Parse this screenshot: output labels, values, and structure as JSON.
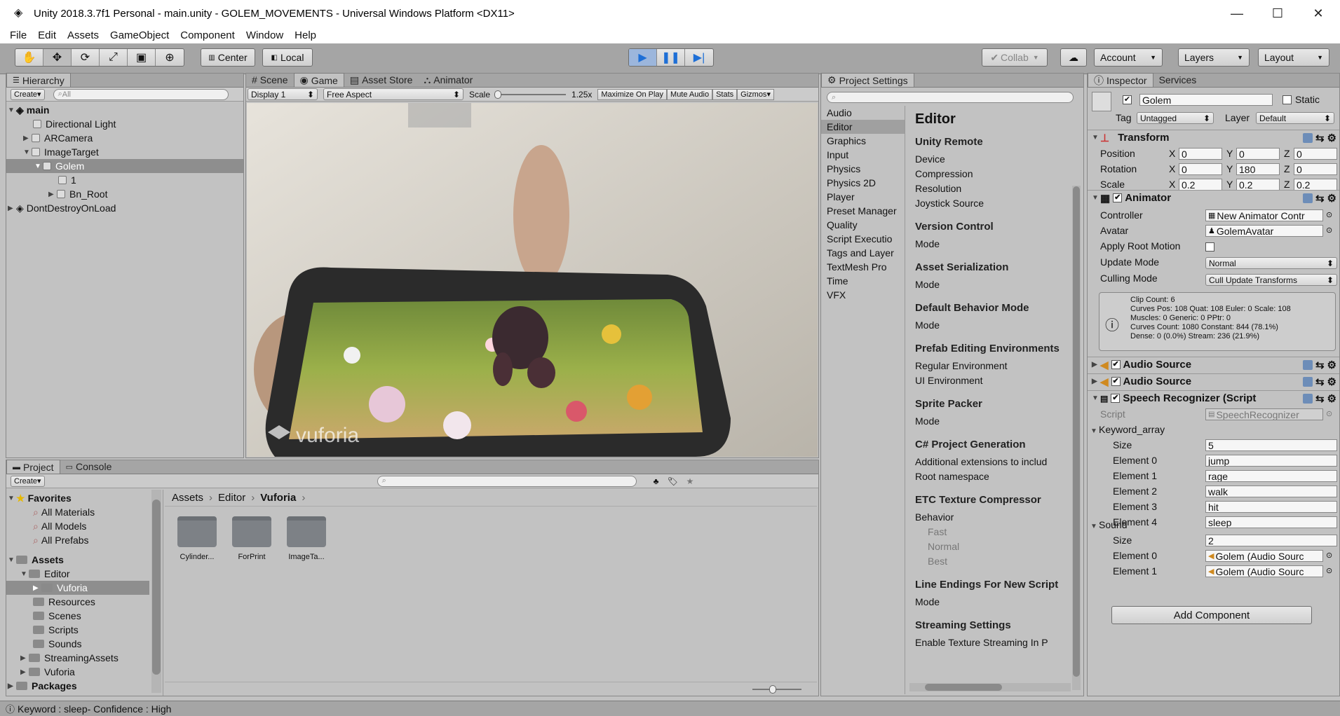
{
  "window": {
    "title": "Unity 2018.3.7f1 Personal - main.unity - GOLEM_MOVEMENTS - Universal Windows Platform <DX11>",
    "minimize": "—",
    "maximize": "☐",
    "close": "✕"
  },
  "menu": [
    "File",
    "Edit",
    "Assets",
    "GameObject",
    "Component",
    "Window",
    "Help"
  ],
  "toolbar": {
    "pivot": "Center",
    "space": "Local",
    "collab": "Collab",
    "account": "Account",
    "layers": "Layers",
    "layout": "Layout"
  },
  "hierarchy": {
    "tab": "Hierarchy",
    "create": "Create",
    "search_placeholder": "All",
    "items": [
      "main",
      "Directional Light",
      "ARCamera",
      "ImageTarget",
      "Golem",
      "1",
      "Bn_Root",
      "DontDestroyOnLoad"
    ]
  },
  "sceneTabs": {
    "scene": "Scene",
    "game": "Game",
    "store": "Asset Store",
    "animator": "Animator"
  },
  "gameBar": {
    "display": "Display 1",
    "aspect": "Free Aspect",
    "scale_label": "Scale",
    "scale_value": "1.25x",
    "max": "Maximize On Play",
    "mute": "Mute Audio",
    "stats": "Stats",
    "gizmos": "Gizmos"
  },
  "game": {
    "watermark": "vuforia"
  },
  "projectSettings": {
    "tab": "Project Settings",
    "categories": [
      "Audio",
      "Editor",
      "Graphics",
      "Input",
      "Physics",
      "Physics 2D",
      "Player",
      "Preset Manager",
      "Quality",
      "Script Executio",
      "Tags and Layer",
      "TextMesh Pro",
      "Time",
      "VFX"
    ],
    "title": "Editor",
    "sections": [
      {
        "h": "Unity Remote",
        "items": [
          "Device",
          "Compression",
          "Resolution",
          "Joystick Source"
        ]
      },
      {
        "h": "Version Control",
        "items": [
          "Mode"
        ]
      },
      {
        "h": "Asset Serialization",
        "items": [
          "Mode"
        ]
      },
      {
        "h": "Default Behavior Mode",
        "items": [
          "Mode"
        ]
      },
      {
        "h": "Prefab Editing Environments",
        "items": [
          "Regular Environment",
          "UI Environment"
        ]
      },
      {
        "h": "Sprite Packer",
        "items": [
          "Mode"
        ]
      },
      {
        "h": "C# Project Generation",
        "items": [
          "Additional extensions to includ",
          "Root namespace"
        ]
      },
      {
        "h": "ETC Texture Compressor",
        "items": [
          "Behavior"
        ],
        "sub": [
          "Fast",
          "Normal",
          "Best"
        ]
      },
      {
        "h": "Line Endings For New Script",
        "items": [
          "Mode"
        ]
      },
      {
        "h": "Streaming Settings",
        "items": [
          "Enable Texture Streaming In P"
        ]
      }
    ]
  },
  "inspector": {
    "tab": "Inspector",
    "services": "Services",
    "name": "Golem",
    "static": "Static",
    "tag_label": "Tag",
    "tag": "Untagged",
    "layer_label": "Layer",
    "layer": "Default",
    "transform": {
      "title": "Transform",
      "rows": [
        {
          "label": "Position",
          "x": "0",
          "y": "0",
          "z": "0"
        },
        {
          "label": "Rotation",
          "x": "0",
          "y": "180",
          "z": "0"
        },
        {
          "label": "Scale",
          "x": "0.2",
          "y": "0.2",
          "z": "0.2"
        }
      ]
    },
    "animator": {
      "title": "Animator",
      "controller_label": "Controller",
      "controller": "New Animator Contr",
      "avatar_label": "Avatar",
      "avatar": "GolemAvatar",
      "root_label": "Apply Root Motion",
      "update_label": "Update Mode",
      "update": "Normal",
      "culling_label": "Culling Mode",
      "culling": "Cull Update Transforms",
      "info": [
        "Clip Count: 6",
        "Curves Pos: 108 Quat: 108 Euler: 0 Scale: 108",
        "Muscles: 0 Generic: 0 PPtr: 0",
        "Curves Count: 1080 Constant: 844 (78.1%)",
        "Dense: 0 (0.0%) Stream: 236 (21.9%)"
      ]
    },
    "audio1": "Audio Source",
    "audio2": "Audio Source",
    "speech": {
      "title": "Speech Recognizer (Script",
      "script_label": "Script",
      "script": "SpeechRecognizer",
      "kw_label": "Keyword_array",
      "size_label": "Size",
      "kw_size": "5",
      "keywords": [
        {
          "label": "Element 0",
          "v": "jump"
        },
        {
          "label": "Element 1",
          "v": "rage"
        },
        {
          "label": "Element 2",
          "v": "walk"
        },
        {
          "label": "Element 3",
          "v": "hit"
        },
        {
          "label": "Element 4",
          "v": "sleep"
        }
      ],
      "sound_label": "Sound",
      "sound_size": "2",
      "sounds": [
        {
          "label": "Element 0",
          "v": "Golem (Audio Sourc"
        },
        {
          "label": "Element 1",
          "v": "Golem (Audio Sourc"
        }
      ]
    },
    "add": "Add Component"
  },
  "project": {
    "tab": "Project",
    "console": "Console",
    "create": "Create",
    "favorites": "Favorites",
    "fav_items": [
      "All Materials",
      "All Models",
      "All Prefabs"
    ],
    "assets": "Assets",
    "tree": [
      "Editor",
      "Vuforia",
      "Resources",
      "Scenes",
      "Scripts",
      "Sounds",
      "StreamingAssets",
      "Vuforia"
    ],
    "packages": "Packages",
    "breadcrumb": [
      "Assets",
      "Editor",
      "Vuforia"
    ],
    "folders": [
      "Cylinder...",
      "ForPrint",
      "ImageTa..."
    ]
  },
  "status": "Keyword : sleep- Confidence : High"
}
